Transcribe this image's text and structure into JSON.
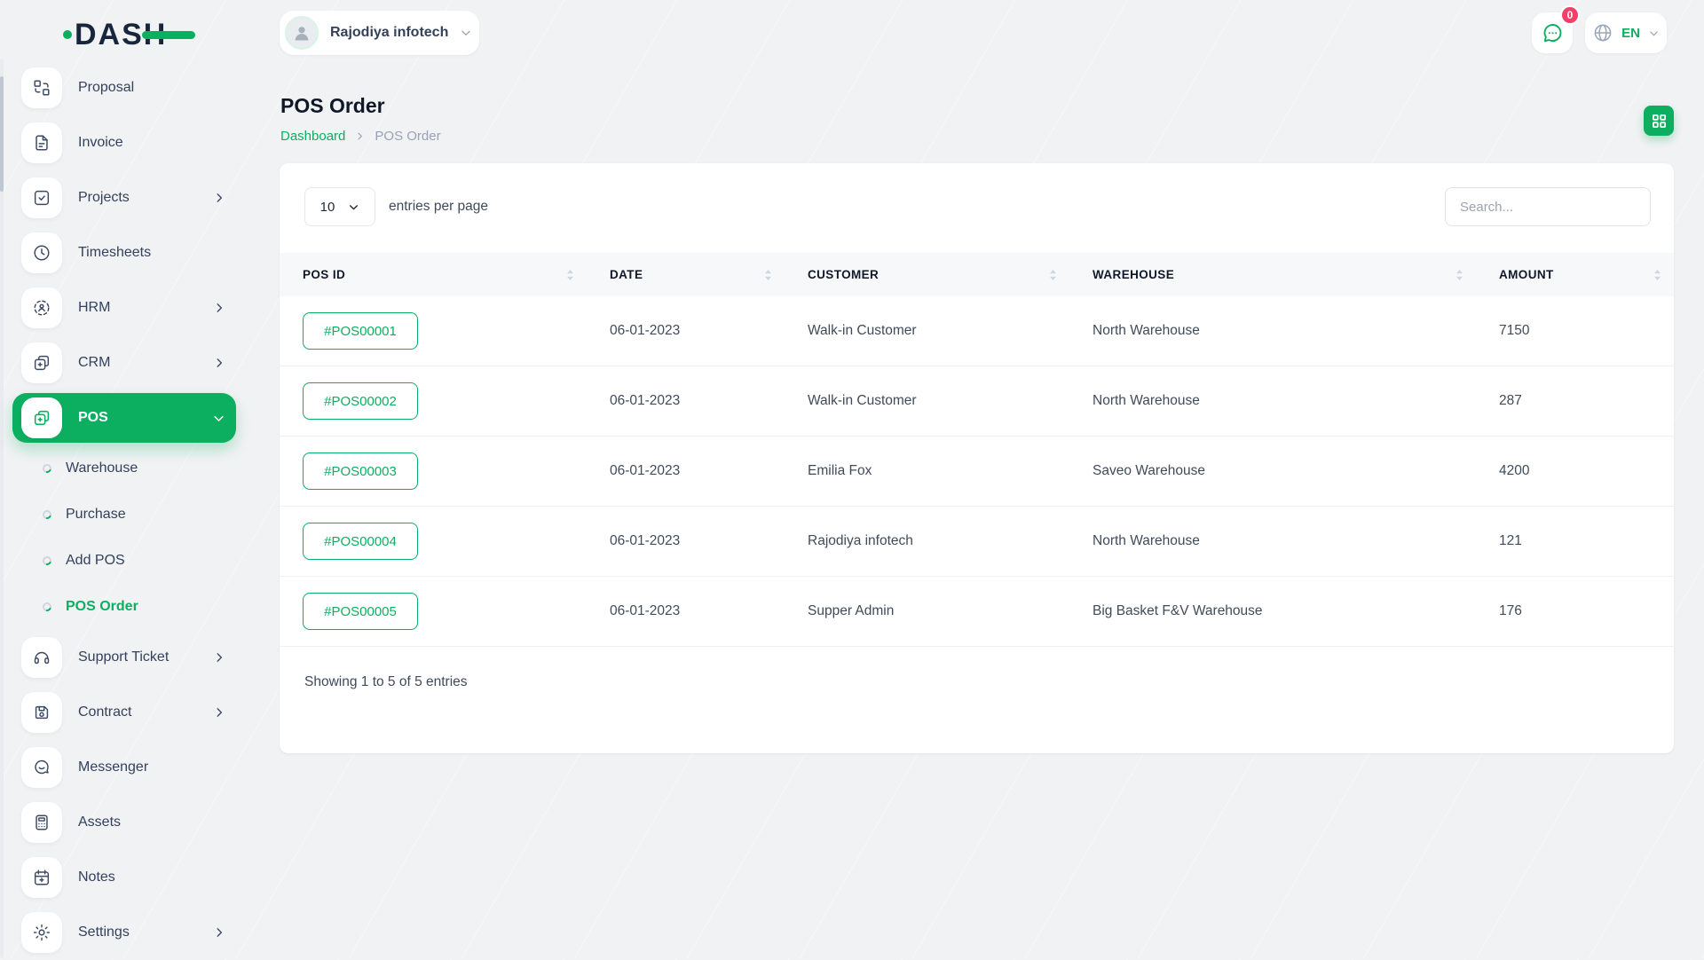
{
  "brand": {
    "name": "DASH"
  },
  "topbar": {
    "workspace_name": "Rajodiya infotech",
    "notification_badge": "0",
    "language": "EN"
  },
  "page": {
    "title": "POS Order",
    "breadcrumb_home": "Dashboard",
    "breadcrumb_current": "POS Order"
  },
  "controls": {
    "page_size": "10",
    "entries_label": "entries per page",
    "search_placeholder": "Search..."
  },
  "sidebar": {
    "items": [
      {
        "label": "Proposal"
      },
      {
        "label": "Invoice"
      },
      {
        "label": "Projects"
      },
      {
        "label": "Timesheets"
      },
      {
        "label": "HRM"
      },
      {
        "label": "CRM"
      },
      {
        "label": "POS"
      },
      {
        "label": "Warehouse"
      },
      {
        "label": "Purchase"
      },
      {
        "label": "Add POS"
      },
      {
        "label": "POS Order"
      },
      {
        "label": "Support Ticket"
      },
      {
        "label": "Contract"
      },
      {
        "label": "Messenger"
      },
      {
        "label": "Assets"
      },
      {
        "label": "Notes"
      },
      {
        "label": "Settings"
      }
    ]
  },
  "table": {
    "columns": [
      "POS ID",
      "DATE",
      "CUSTOMER",
      "WAREHOUSE",
      "AMOUNT"
    ],
    "rows": [
      {
        "pos_id": "#POS00001",
        "date": "06-01-2023",
        "customer": "Walk-in Customer",
        "warehouse": "North Warehouse",
        "amount": "7150"
      },
      {
        "pos_id": "#POS00002",
        "date": "06-01-2023",
        "customer": "Walk-in Customer",
        "warehouse": "North Warehouse",
        "amount": "287"
      },
      {
        "pos_id": "#POS00003",
        "date": "06-01-2023",
        "customer": "Emilia Fox",
        "warehouse": "Saveo Warehouse",
        "amount": "4200"
      },
      {
        "pos_id": "#POS00004",
        "date": "06-01-2023",
        "customer": "Rajodiya infotech",
        "warehouse": "North Warehouse",
        "amount": "121"
      },
      {
        "pos_id": "#POS00005",
        "date": "06-01-2023",
        "customer": "Supper Admin",
        "warehouse": "Big Basket F&V Warehouse",
        "amount": "176"
      }
    ],
    "footer": "Showing 1 to 5 of 5 entries"
  },
  "colors": {
    "primary": "#0caf60",
    "badge": "#f43f68"
  }
}
